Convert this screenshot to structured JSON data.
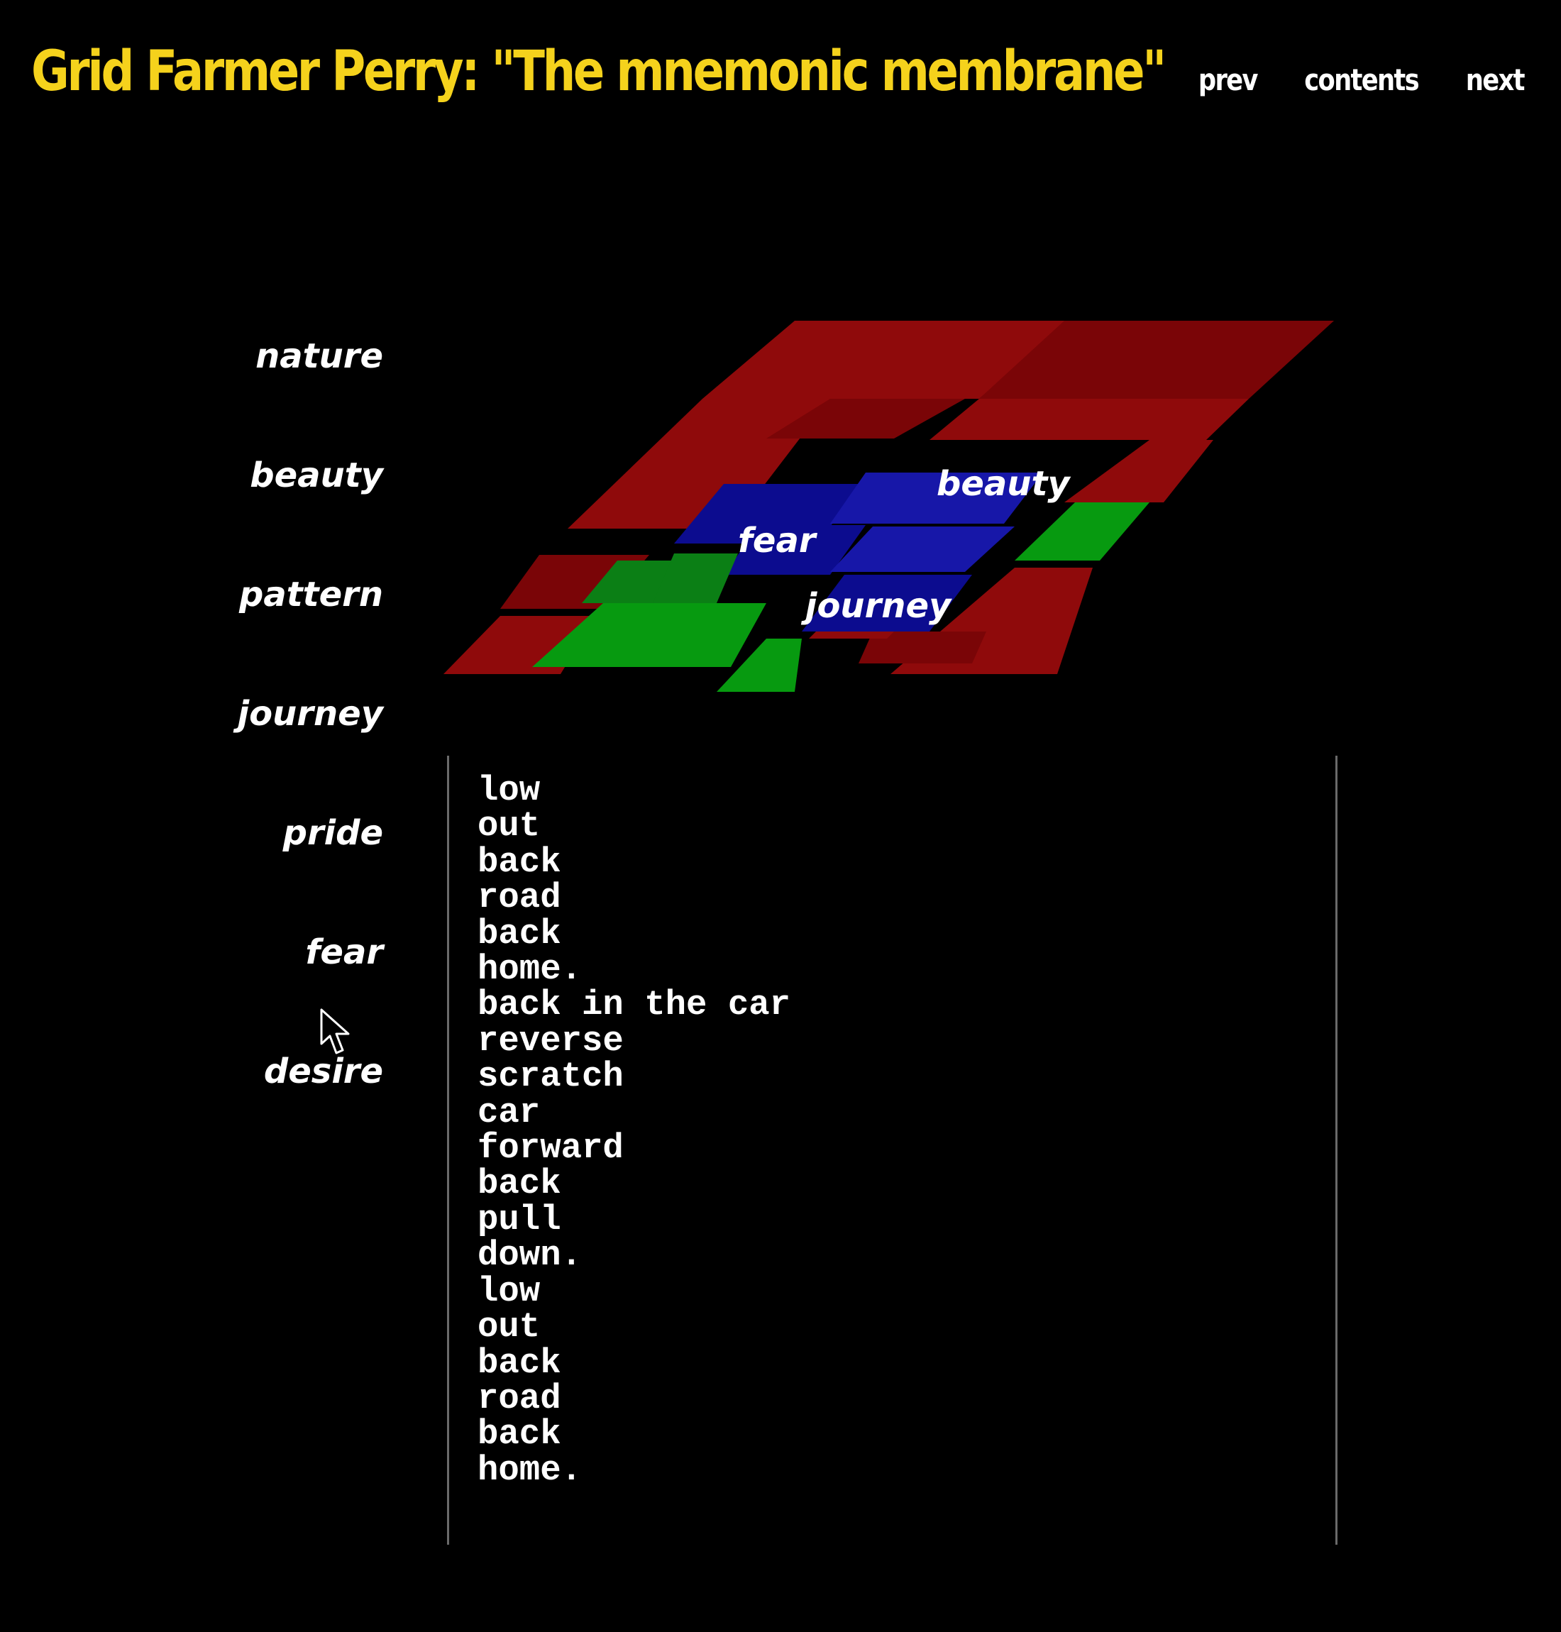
{
  "header": {
    "title": "Grid Farmer Perry: \"The mnemonic membrane\"",
    "nav": [
      "prev",
      "contents",
      "next"
    ]
  },
  "categories": [
    "nature",
    "beauty",
    "pattern",
    "journey",
    "pride",
    "fear",
    "desire"
  ],
  "membrane": {
    "labels": [
      "beauty",
      "fear",
      "journey"
    ],
    "colors": {
      "red": "#8f0a0b",
      "red_alt": "#7a0507",
      "blue": "#0c0c8f",
      "blue_alt": "#1717a8",
      "green": "#079a10",
      "green_alt": "#0b7f15"
    }
  },
  "poem": {
    "lines": [
      "low",
      "out",
      "back",
      "road",
      "back",
      "home.",
      "back in the car",
      "reverse",
      "scratch",
      "car",
      "forward",
      "back",
      "pull",
      "down.",
      "low",
      "out",
      "back",
      "road",
      "back",
      "home."
    ]
  },
  "cursor": {
    "icon": "mouse-pointer-icon"
  }
}
